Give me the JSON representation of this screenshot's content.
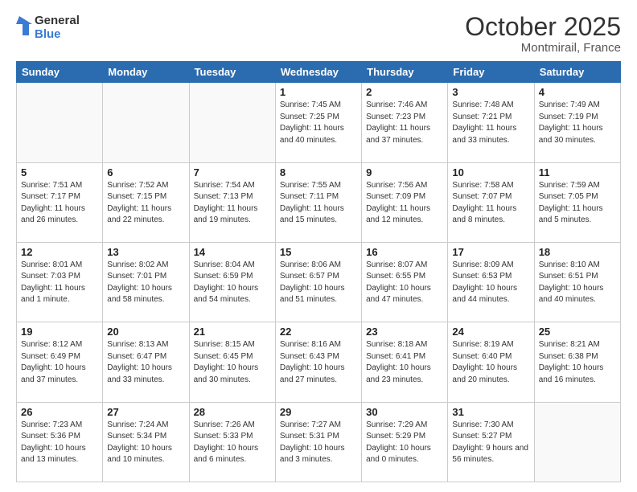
{
  "logo": {
    "line1": "General",
    "line2": "Blue"
  },
  "header": {
    "month": "October 2025",
    "location": "Montmirail, France"
  },
  "weekdays": [
    "Sunday",
    "Monday",
    "Tuesday",
    "Wednesday",
    "Thursday",
    "Friday",
    "Saturday"
  ],
  "weeks": [
    [
      {
        "day": "",
        "info": ""
      },
      {
        "day": "",
        "info": ""
      },
      {
        "day": "",
        "info": ""
      },
      {
        "day": "1",
        "info": "Sunrise: 7:45 AM\nSunset: 7:25 PM\nDaylight: 11 hours\nand 40 minutes."
      },
      {
        "day": "2",
        "info": "Sunrise: 7:46 AM\nSunset: 7:23 PM\nDaylight: 11 hours\nand 37 minutes."
      },
      {
        "day": "3",
        "info": "Sunrise: 7:48 AM\nSunset: 7:21 PM\nDaylight: 11 hours\nand 33 minutes."
      },
      {
        "day": "4",
        "info": "Sunrise: 7:49 AM\nSunset: 7:19 PM\nDaylight: 11 hours\nand 30 minutes."
      }
    ],
    [
      {
        "day": "5",
        "info": "Sunrise: 7:51 AM\nSunset: 7:17 PM\nDaylight: 11 hours\nand 26 minutes."
      },
      {
        "day": "6",
        "info": "Sunrise: 7:52 AM\nSunset: 7:15 PM\nDaylight: 11 hours\nand 22 minutes."
      },
      {
        "day": "7",
        "info": "Sunrise: 7:54 AM\nSunset: 7:13 PM\nDaylight: 11 hours\nand 19 minutes."
      },
      {
        "day": "8",
        "info": "Sunrise: 7:55 AM\nSunset: 7:11 PM\nDaylight: 11 hours\nand 15 minutes."
      },
      {
        "day": "9",
        "info": "Sunrise: 7:56 AM\nSunset: 7:09 PM\nDaylight: 11 hours\nand 12 minutes."
      },
      {
        "day": "10",
        "info": "Sunrise: 7:58 AM\nSunset: 7:07 PM\nDaylight: 11 hours\nand 8 minutes."
      },
      {
        "day": "11",
        "info": "Sunrise: 7:59 AM\nSunset: 7:05 PM\nDaylight: 11 hours\nand 5 minutes."
      }
    ],
    [
      {
        "day": "12",
        "info": "Sunrise: 8:01 AM\nSunset: 7:03 PM\nDaylight: 11 hours\nand 1 minute."
      },
      {
        "day": "13",
        "info": "Sunrise: 8:02 AM\nSunset: 7:01 PM\nDaylight: 10 hours\nand 58 minutes."
      },
      {
        "day": "14",
        "info": "Sunrise: 8:04 AM\nSunset: 6:59 PM\nDaylight: 10 hours\nand 54 minutes."
      },
      {
        "day": "15",
        "info": "Sunrise: 8:06 AM\nSunset: 6:57 PM\nDaylight: 10 hours\nand 51 minutes."
      },
      {
        "day": "16",
        "info": "Sunrise: 8:07 AM\nSunset: 6:55 PM\nDaylight: 10 hours\nand 47 minutes."
      },
      {
        "day": "17",
        "info": "Sunrise: 8:09 AM\nSunset: 6:53 PM\nDaylight: 10 hours\nand 44 minutes."
      },
      {
        "day": "18",
        "info": "Sunrise: 8:10 AM\nSunset: 6:51 PM\nDaylight: 10 hours\nand 40 minutes."
      }
    ],
    [
      {
        "day": "19",
        "info": "Sunrise: 8:12 AM\nSunset: 6:49 PM\nDaylight: 10 hours\nand 37 minutes."
      },
      {
        "day": "20",
        "info": "Sunrise: 8:13 AM\nSunset: 6:47 PM\nDaylight: 10 hours\nand 33 minutes."
      },
      {
        "day": "21",
        "info": "Sunrise: 8:15 AM\nSunset: 6:45 PM\nDaylight: 10 hours\nand 30 minutes."
      },
      {
        "day": "22",
        "info": "Sunrise: 8:16 AM\nSunset: 6:43 PM\nDaylight: 10 hours\nand 27 minutes."
      },
      {
        "day": "23",
        "info": "Sunrise: 8:18 AM\nSunset: 6:41 PM\nDaylight: 10 hours\nand 23 minutes."
      },
      {
        "day": "24",
        "info": "Sunrise: 8:19 AM\nSunset: 6:40 PM\nDaylight: 10 hours\nand 20 minutes."
      },
      {
        "day": "25",
        "info": "Sunrise: 8:21 AM\nSunset: 6:38 PM\nDaylight: 10 hours\nand 16 minutes."
      }
    ],
    [
      {
        "day": "26",
        "info": "Sunrise: 7:23 AM\nSunset: 5:36 PM\nDaylight: 10 hours\nand 13 minutes."
      },
      {
        "day": "27",
        "info": "Sunrise: 7:24 AM\nSunset: 5:34 PM\nDaylight: 10 hours\nand 10 minutes."
      },
      {
        "day": "28",
        "info": "Sunrise: 7:26 AM\nSunset: 5:33 PM\nDaylight: 10 hours\nand 6 minutes."
      },
      {
        "day": "29",
        "info": "Sunrise: 7:27 AM\nSunset: 5:31 PM\nDaylight: 10 hours\nand 3 minutes."
      },
      {
        "day": "30",
        "info": "Sunrise: 7:29 AM\nSunset: 5:29 PM\nDaylight: 10 hours\nand 0 minutes."
      },
      {
        "day": "31",
        "info": "Sunrise: 7:30 AM\nSunset: 5:27 PM\nDaylight: 9 hours\nand 56 minutes."
      },
      {
        "day": "",
        "info": ""
      }
    ]
  ]
}
